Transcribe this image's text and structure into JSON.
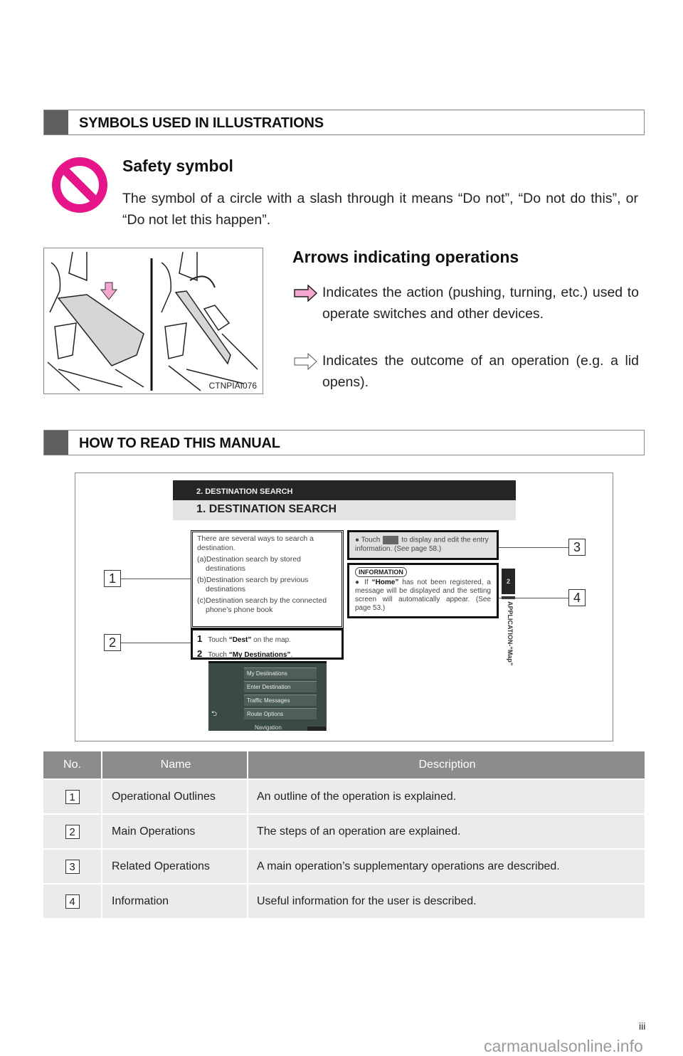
{
  "sections": {
    "symbols": {
      "title": "SYMBOLS USED IN ILLUSTRATIONS"
    },
    "how_to_read": {
      "title": "HOW TO READ THIS MANUAL"
    }
  },
  "safety": {
    "title": "Safety symbol",
    "text": "The symbol of a circle with a slash through it means “Do not”, “Do not do this”, or “Do not let this happen”.",
    "icon_color": "#e6168a"
  },
  "illustration": {
    "code": "CTNPIAI076"
  },
  "arrows": {
    "title": "Arrows indicating operations",
    "items": [
      {
        "icon": "action-arrow-icon",
        "text": "Indicates the action (pushing, turning, etc.) used to operate switches and other devices.",
        "fill": "#f4a6cf"
      },
      {
        "icon": "outcome-arrow-icon",
        "text": "Indicates the outcome of an operation (e.g. a lid opens).",
        "fill": "#ffffff"
      }
    ]
  },
  "figure": {
    "chapter_bar": "2. DESTINATION SEARCH",
    "section_bar": "1. DESTINATION SEARCH",
    "outline": {
      "intro": "There are several ways to search a destination.",
      "items": [
        "(a)Destination search by stored destinations",
        "(b)Destination search by previous destinations",
        "(c)Destination search by the connected phone’s phone book"
      ]
    },
    "steps": [
      {
        "num": "1",
        "pre": "Touch ",
        "bold": "“Dest”",
        "post": " on the map."
      },
      {
        "num": "2",
        "pre": "Touch ",
        "bold": "“My Destinations”",
        "post": "."
      }
    ],
    "related": {
      "pre": "● Touch",
      "post": "to display and edit the entry information. (See page 58.)"
    },
    "information": {
      "label": "INFORMATION",
      "pre": "● If ",
      "bold": "“Home”",
      "post": " has not been registered, a message will be displayed and the setting screen will automatically appear. (See page 53.)"
    },
    "chapter_tab": "2",
    "vertical_label": "APPLICATION-“Map”",
    "screen": {
      "menu": [
        "My Destinations",
        "Enter Destination",
        "Traffic Messages",
        "Route Options"
      ],
      "back": "⮌",
      "bottom_label": "Navigation"
    },
    "callouts": [
      "1",
      "2",
      "3",
      "4"
    ]
  },
  "table": {
    "headers": [
      "No.",
      "Name",
      "Description"
    ],
    "rows": [
      {
        "no": "1",
        "name": "Operational Outlines",
        "desc": "An outline of the operation is explained."
      },
      {
        "no": "2",
        "name": "Main Operations",
        "desc": "The steps of an operation are explained."
      },
      {
        "no": "3",
        "name": "Related Operations",
        "desc": "A main operation’s supplementary operations are described."
      },
      {
        "no": "4",
        "name": "Information",
        "desc": "Useful information for the user is described."
      }
    ]
  },
  "footer": {
    "page": "iii",
    "watermark": "carmanualsonline.info"
  }
}
